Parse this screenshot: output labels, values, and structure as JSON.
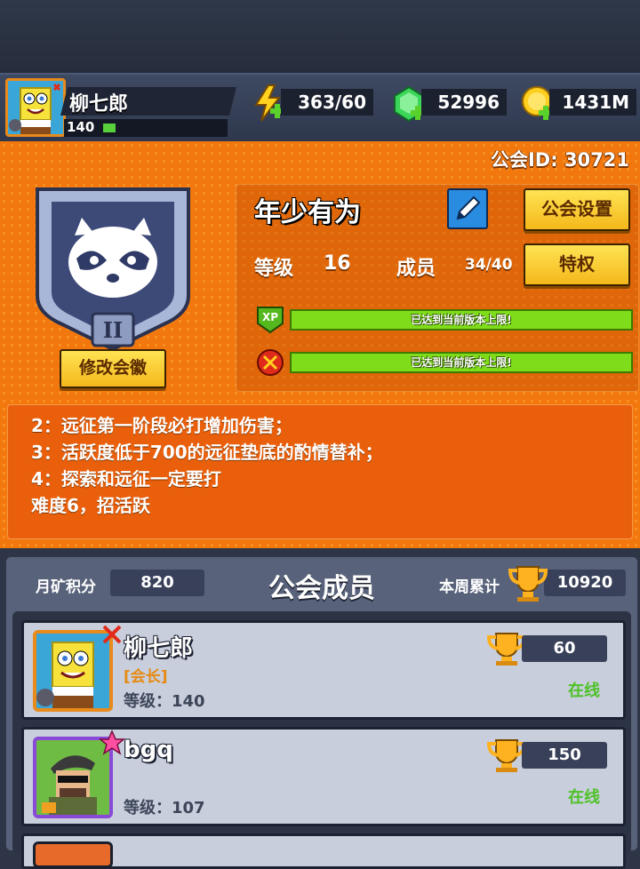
{
  "player": {
    "name": "柳七郎",
    "level": "140"
  },
  "resources": {
    "energy": "363/60",
    "gems": "52996",
    "gold": "1431M"
  },
  "guild": {
    "id_label": "公会ID: 30721",
    "name": "年少有为",
    "settings_label": "公会设置",
    "level_label": "等级",
    "level_value": "16",
    "members_label": "成员",
    "members_value": "34/40",
    "privilege_label": "特权",
    "badge_button": "修改会徽",
    "badge_rank": "II",
    "xp_badge": "XP",
    "xp_bar_text": "已达到当前版本上限!",
    "tech_bar_text": "已达到当前版本上限!",
    "xp_progress": 1.0,
    "tech_progress": 1.0
  },
  "notice": [
    "2：远征第一阶段必打增加伤害；",
    "3：活跃度低于700的远征垫底的酌情替补；",
    "4：探索和远征一定要打",
    "难度6，招活跃"
  ],
  "members_panel": {
    "title": "公会成员",
    "monthly_label": "月矿积分",
    "monthly_value": "820",
    "weekly_label": "本周累计",
    "weekly_value": "10920"
  },
  "members": [
    {
      "name": "柳七郎",
      "role": "[会长]",
      "level": "等级：140",
      "score": "60",
      "status": "在线"
    },
    {
      "name": "bgq",
      "role": "",
      "level": "等级：107",
      "score": "150",
      "status": "在线"
    }
  ],
  "colors": {
    "orange": "#f2780e",
    "yellow_button": "#f4b81b",
    "green_bar": "#7fdc1a",
    "online": "#4ec128"
  }
}
